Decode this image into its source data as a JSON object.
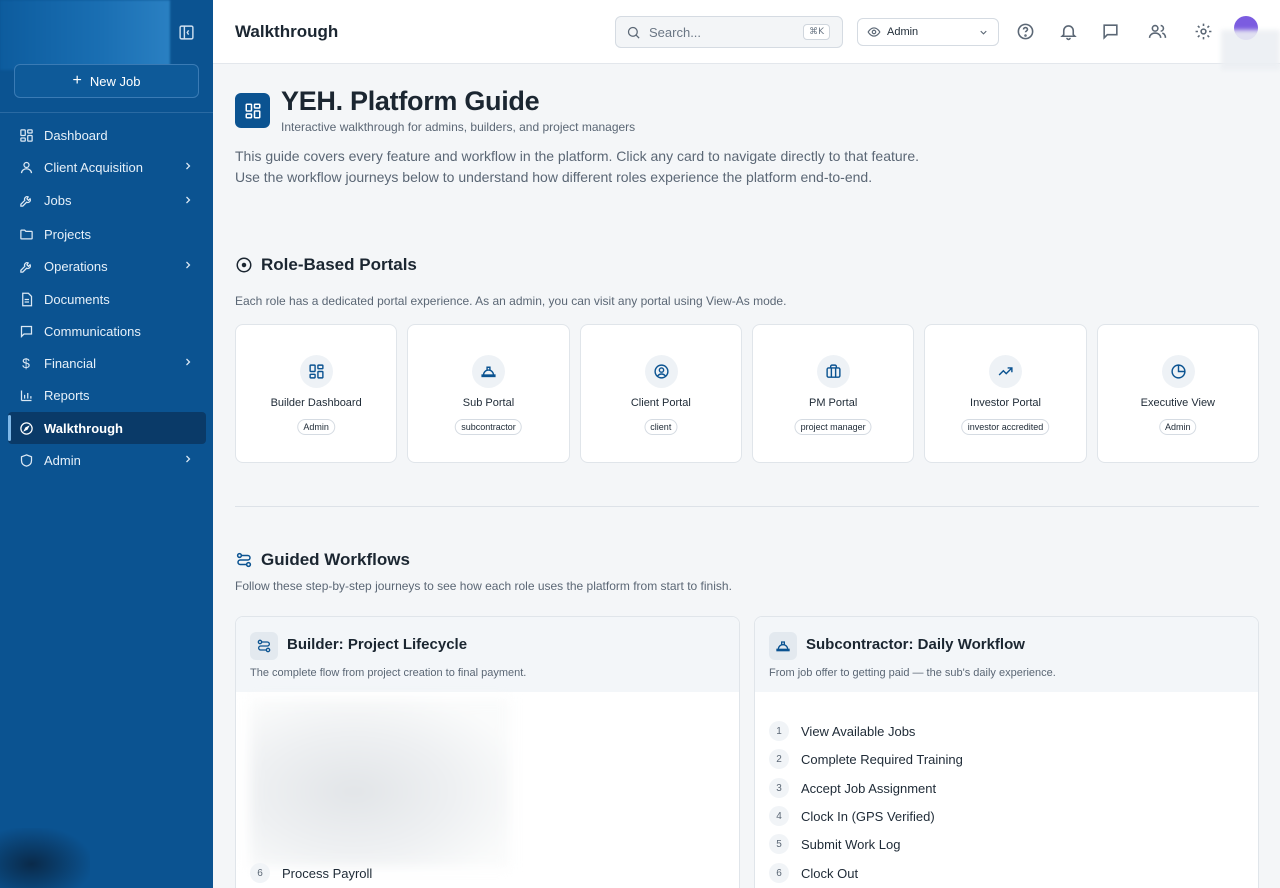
{
  "sidebar": {
    "new_job_label": "New Job",
    "items": [
      {
        "label": "Dashboard",
        "icon": "dashboard-icon",
        "has_chevron": false
      },
      {
        "label": "Client Acquisition",
        "icon": "user-icon",
        "has_chevron": true
      },
      {
        "label": "Jobs",
        "icon": "wrench-icon",
        "has_chevron": true
      },
      {
        "label": "Projects",
        "icon": "folder-icon",
        "has_chevron": false
      },
      {
        "label": "Operations",
        "icon": "wrench-icon",
        "has_chevron": true
      },
      {
        "label": "Documents",
        "icon": "document-icon",
        "has_chevron": false
      },
      {
        "label": "Communications",
        "icon": "message-icon",
        "has_chevron": false
      },
      {
        "label": "Financial",
        "icon": "dollar-icon",
        "has_chevron": true
      },
      {
        "label": "Reports",
        "icon": "bar-chart-icon",
        "has_chevron": false
      },
      {
        "label": "Walkthrough",
        "icon": "compass-icon",
        "has_chevron": false,
        "active": true
      },
      {
        "label": "Admin",
        "icon": "shield-icon",
        "has_chevron": true
      }
    ]
  },
  "topbar": {
    "title": "Walkthrough",
    "search_placeholder": "Search...",
    "search_shortcut": "⌘K",
    "role_selected": "Admin"
  },
  "hero": {
    "title": "YEH. Platform Guide",
    "subtitle": "Interactive walkthrough for admins, builders, and project managers",
    "intro": "This guide covers every feature and workflow in the platform. Click any card to navigate directly to that feature. Use the workflow journeys below to understand how different roles experience the platform end-to-end."
  },
  "portals_section": {
    "title": "Role-Based Portals",
    "description": "Each role has a dedicated portal experience. As an admin, you can visit any portal using View-As mode.",
    "cards": [
      {
        "name": "Builder Dashboard",
        "badge": "Admin",
        "icon": "grid-icon"
      },
      {
        "name": "Sub Portal",
        "badge": "subcontractor",
        "icon": "hard-hat-icon"
      },
      {
        "name": "Client Portal",
        "badge": "client",
        "icon": "user-circle-icon"
      },
      {
        "name": "PM Portal",
        "badge": "project manager",
        "icon": "briefcase-icon"
      },
      {
        "name": "Investor Portal",
        "badge": "investor accredited",
        "icon": "trending-up-icon"
      },
      {
        "name": "Executive View",
        "badge": "Admin",
        "icon": "pie-chart-icon"
      }
    ]
  },
  "workflows_section": {
    "title": "Guided Workflows",
    "description": "Follow these step-by-step journeys to see how each role uses the platform from start to finish.",
    "cards": [
      {
        "title": "Builder: Project Lifecycle",
        "description": "The complete flow from project creation to final payment.",
        "steps": [
          {
            "num": "6",
            "label": "Process Payroll"
          }
        ]
      },
      {
        "title": "Subcontractor: Daily Workflow",
        "description": "From job offer to getting paid — the sub's daily experience.",
        "steps": [
          {
            "num": "1",
            "label": "View Available Jobs"
          },
          {
            "num": "2",
            "label": "Complete Required Training"
          },
          {
            "num": "3",
            "label": "Accept Job Assignment"
          },
          {
            "num": "4",
            "label": "Clock In (GPS Verified)"
          },
          {
            "num": "5",
            "label": "Submit Work Log"
          },
          {
            "num": "6",
            "label": "Clock Out"
          }
        ]
      }
    ]
  },
  "colors": {
    "sidebar_bg": "#0b5391",
    "sidebar_active": "#0a3a68",
    "accent": "#0b5391",
    "avatar": "#7b5ce0"
  }
}
